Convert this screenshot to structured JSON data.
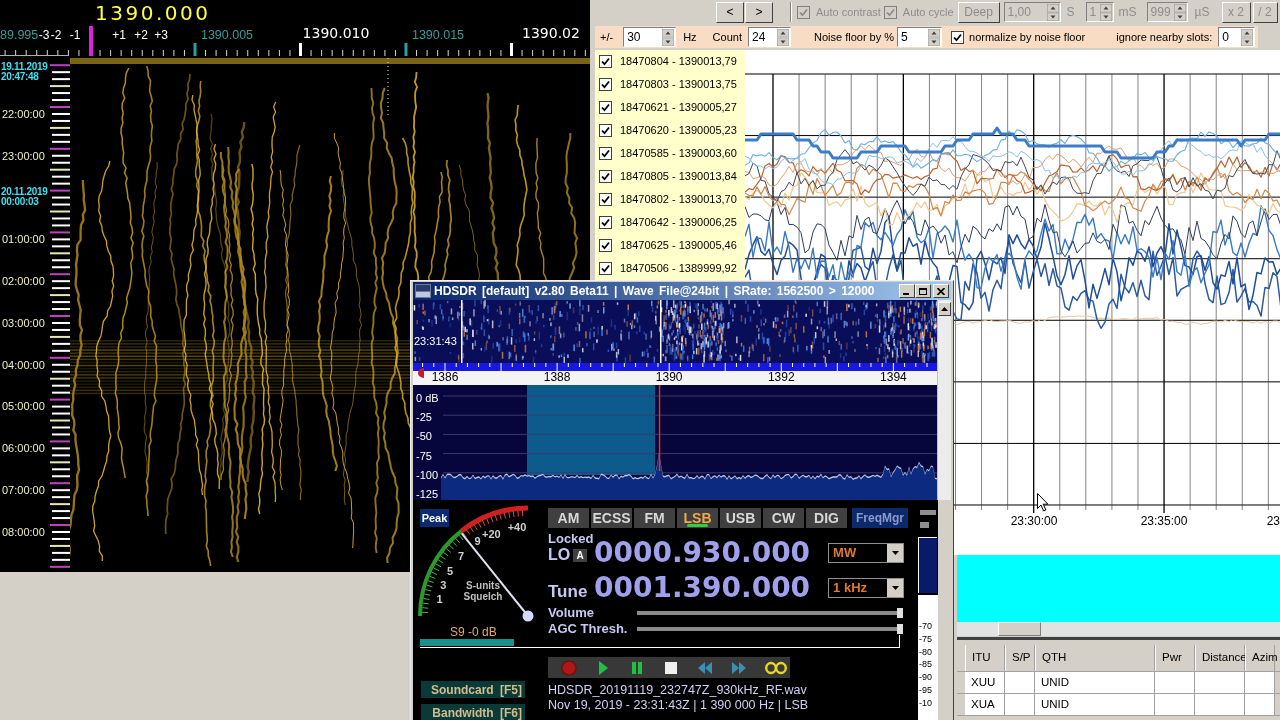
{
  "spectrum_window": {
    "center_frequency": "1390.000",
    "offset_labels": [
      "-3",
      "-2",
      "-1",
      "+1",
      "+2",
      "+3"
    ],
    "frequency_labels": [
      {
        "text": "89.995",
        "kind": "minor"
      },
      {
        "text": "1390.005",
        "kind": "minor"
      },
      {
        "text": "1390.010",
        "kind": "major"
      },
      {
        "text": "1390.015",
        "kind": "minor"
      },
      {
        "text": "1390.02",
        "kind": "major"
      }
    ],
    "time_labels": [
      {
        "kind": "date",
        "date": "19.11.2019",
        "time": "20:47:48"
      },
      {
        "kind": "hour",
        "time": "22:00:00"
      },
      {
        "kind": "hour",
        "time": "23:00:00"
      },
      {
        "kind": "date",
        "date": "20.11.2019",
        "time": "00:00:03"
      },
      {
        "kind": "hour",
        "time": "01:00:00"
      },
      {
        "kind": "hour",
        "time": "02:00:00"
      },
      {
        "kind": "hour",
        "time": "03:00:00"
      },
      {
        "kind": "hour",
        "time": "04:00:00"
      },
      {
        "kind": "hour",
        "time": "05:00:00"
      },
      {
        "kind": "hour",
        "time": "06:00:00"
      },
      {
        "kind": "hour",
        "time": "07:00:00"
      },
      {
        "kind": "hour",
        "time": "08:00:00"
      }
    ]
  },
  "analysis_window": {
    "toolbar": {
      "nav_buttons": [
        "<",
        ">"
      ],
      "checkboxes": [
        {
          "label": "Auto contrast",
          "checked": true,
          "disabled": true
        },
        {
          "label": "Auto cycle",
          "checked": true,
          "disabled": true
        }
      ],
      "deep_button": {
        "label": "Deep",
        "disabled": true
      },
      "spinners": [
        {
          "value": "1,00",
          "unit": "S",
          "disabled": true
        },
        {
          "value": "1",
          "unit": "mS",
          "disabled": true
        },
        {
          "value": "999",
          "unit": "µS",
          "disabled": true
        }
      ],
      "zoom_buttons": [
        {
          "label": "x 2",
          "disabled": true
        },
        {
          "label": "/ 2",
          "disabled": true
        }
      ]
    },
    "settings": {
      "tolerance_label": "+/-",
      "tolerance": "30",
      "tolerance_unit": "Hz",
      "count_label": "Count",
      "count": "24",
      "noise_floor_label": "Noise floor by %",
      "noise_floor": "5",
      "normalize": {
        "label": "normalize by noise floor",
        "checked": true
      },
      "ignore_label": "ignore nearby slots:",
      "ignore_slots": "0"
    },
    "stations": [
      {
        "label": "18470804 - 1390013,79",
        "checked": true
      },
      {
        "label": "18470803 - 1390013,75",
        "checked": true
      },
      {
        "label": "18470621 - 1390005,27",
        "checked": true
      },
      {
        "label": "18470620 - 1390005,23",
        "checked": true
      },
      {
        "label": "18470585 - 1390003,60",
        "checked": true
      },
      {
        "label": "18470805 - 1390013,84",
        "checked": true
      },
      {
        "label": "18470802 - 1390013,70",
        "checked": true
      },
      {
        "label": "18470642 - 1390006,25",
        "checked": true
      },
      {
        "label": "18470625 - 1390005,46",
        "checked": true
      },
      {
        "label": "18470506 - 1389999,92",
        "checked": true
      }
    ],
    "chart": {
      "time_labels": [
        "23:30:00",
        "23:35:00",
        "23"
      ]
    },
    "table": {
      "columns": [
        "ITU",
        "S/P",
        "QTH",
        "Pwr",
        "Distance",
        "Azim"
      ],
      "rows": [
        {
          "itu": "XUU",
          "qth": "UNID"
        },
        {
          "itu": "XUA",
          "qth": "UNID"
        }
      ]
    }
  },
  "hdsdr_window": {
    "title": "HDSDR [default] v2.80 Beta11 | Wave File@24bit | SRate: 1562500 > 12000",
    "waterfall_time": "23:31:43",
    "frequency_labels": [
      "1386",
      "1388",
      "1390",
      "1392",
      "1394"
    ],
    "db_labels": [
      "0 dB",
      "-25",
      "-50",
      "-75",
      "-100",
      "-125"
    ],
    "peak_button": "Peak",
    "s_meter": {
      "scale_labels": [
        "+40",
        "+20",
        "9",
        "7",
        "5",
        "3",
        "1"
      ],
      "caption": [
        "S-units",
        "Squelch"
      ],
      "level": 0.57,
      "reading": "S9 -0 dB"
    },
    "modes": [
      {
        "label": "AM",
        "selected": false
      },
      {
        "label": "ECSS",
        "selected": false
      },
      {
        "label": "FM",
        "selected": false
      },
      {
        "label": "LSB",
        "selected": true
      },
      {
        "label": "USB",
        "selected": false
      },
      {
        "label": "CW",
        "selected": false
      },
      {
        "label": "DIG",
        "selected": false
      }
    ],
    "freq_manager": "FreqMgr",
    "lo": {
      "status": "Locked",
      "label": "LO",
      "lock_button": "A",
      "frequency": "0000.930.000",
      "band": "MW"
    },
    "tune": {
      "label": "Tune",
      "frequency": "0001.390.000",
      "step": "1 kHz"
    },
    "sliders": [
      {
        "label": "Volume",
        "level": 1
      },
      {
        "label": "AGC Thresh.",
        "level": 1
      }
    ],
    "playback": [
      {
        "kind": "record"
      },
      {
        "kind": "play"
      },
      {
        "kind": "pause"
      },
      {
        "kind": "stop"
      },
      {
        "kind": "rewind"
      },
      {
        "kind": "fast_forward"
      },
      {
        "kind": "loop"
      }
    ],
    "side_buttons": [
      "Soundcard [F5]",
      "Bandwidth [F6]"
    ],
    "file_name": "HDSDR_20191119_232747Z_930kHz_RF.wav",
    "file_info": "Nov 19, 2019 - 23:31:43Z | 1 390 000 Hz | LSB",
    "level_scale": [
      "-70",
      "-75",
      "-80",
      "-85",
      "-90",
      "-95",
      "-10"
    ]
  }
}
